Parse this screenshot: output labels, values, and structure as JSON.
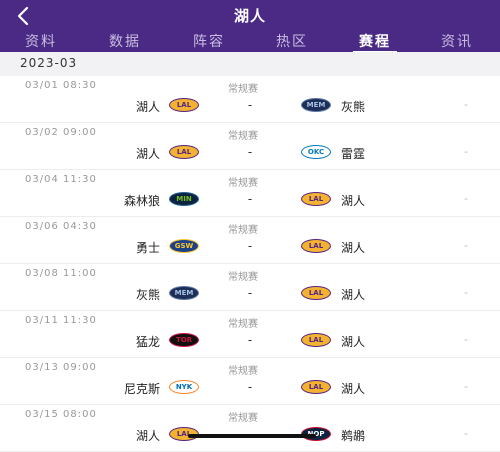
{
  "header": {
    "title": "湖人",
    "tabs": [
      {
        "label": "资料"
      },
      {
        "label": "数据"
      },
      {
        "label": "阵容"
      },
      {
        "label": "热区"
      },
      {
        "label": "赛程"
      },
      {
        "label": "资讯"
      }
    ],
    "active_tab": "赛程"
  },
  "month": "2023-03",
  "games": [
    {
      "time": "03/01 08:30",
      "type": "常规赛",
      "home": "湖人",
      "home_logo": "LAL",
      "score": "-",
      "away": "灰熊",
      "away_logo": "MEM",
      "more": "-"
    },
    {
      "time": "03/02 09:00",
      "type": "常规赛",
      "home": "湖人",
      "home_logo": "LAL",
      "score": "-",
      "away": "雷霆",
      "away_logo": "OKC",
      "more": "-"
    },
    {
      "time": "03/04 11:30",
      "type": "常规赛",
      "home": "森林狼",
      "home_logo": "MIN",
      "score": "-",
      "away": "湖人",
      "away_logo": "LAL",
      "more": "-"
    },
    {
      "time": "03/06 04:30",
      "type": "常规赛",
      "home": "勇士",
      "home_logo": "GSW",
      "score": "-",
      "away": "湖人",
      "away_logo": "LAL",
      "more": "-"
    },
    {
      "time": "03/08 11:00",
      "type": "常规赛",
      "home": "灰熊",
      "home_logo": "MEM",
      "score": "-",
      "away": "湖人",
      "away_logo": "LAL",
      "more": "-"
    },
    {
      "time": "03/11 11:30",
      "type": "常规赛",
      "home": "猛龙",
      "home_logo": "TOR",
      "score": "-",
      "away": "湖人",
      "away_logo": "LAL",
      "more": "-"
    },
    {
      "time": "03/13 09:00",
      "type": "常规赛",
      "home": "尼克斯",
      "home_logo": "NYK",
      "score": "-",
      "away": "湖人",
      "away_logo": "LAL",
      "more": "-"
    },
    {
      "time": "03/15 08:00",
      "type": "常规赛",
      "home": "湖人",
      "home_logo": "LAL",
      "score": "-",
      "away": "鹈鹕",
      "away_logo": "NOP",
      "more": "-"
    }
  ],
  "colors": {
    "header_bg": "#4a2a84",
    "LAL": {
      "bg": "#f3b22f",
      "fg": "#552583",
      "border": "#552583"
    },
    "MEM": {
      "bg": "#1d2f57",
      "fg": "#a8c3e6",
      "border": "#5d76a9"
    },
    "OKC": {
      "bg": "#ffffff",
      "fg": "#007ac1",
      "border": "#007ac1"
    },
    "MIN": {
      "bg": "#0c2340",
      "fg": "#78be20",
      "border": "#236192"
    },
    "GSW": {
      "bg": "#1d428a",
      "fg": "#ffc72c",
      "border": "#ffc72c"
    },
    "TOR": {
      "bg": "#111111",
      "fg": "#ce1141",
      "border": "#ce1141"
    },
    "NYK": {
      "bg": "#ffffff",
      "fg": "#006bb6",
      "border": "#f58426"
    },
    "NOP": {
      "bg": "#0c2340",
      "fg": "#ffffff",
      "border": "#c8102e"
    }
  }
}
